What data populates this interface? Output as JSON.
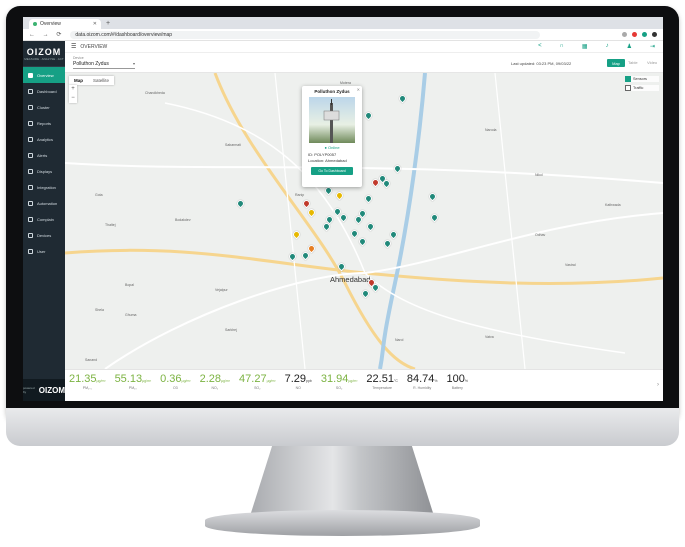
{
  "browser": {
    "tab_title": "Overview",
    "url": "data.oizom.com/#/dashboard/overview/map"
  },
  "sidebar": {
    "brand": "OIZOM",
    "brand_tagline": "MEASURE · ANALYSE · ACT",
    "items": [
      {
        "label": "Overview"
      },
      {
        "label": "Dashboard"
      },
      {
        "label": "Cluster"
      },
      {
        "label": "Reports"
      },
      {
        "label": "Analytics"
      },
      {
        "label": "Alerts"
      },
      {
        "label": "Displays"
      },
      {
        "label": "Integration"
      },
      {
        "label": "Automation"
      },
      {
        "label": "Complain"
      },
      {
        "label": "Devices"
      },
      {
        "label": "User"
      }
    ],
    "footer_prefix": "powered by",
    "footer_brand": "OIZOM"
  },
  "topbar": {
    "menu_icon": "menu-icon",
    "title": "OVERVIEW"
  },
  "subbar": {
    "device_label": "Device",
    "device_value": "Polluthon Zydus",
    "last_updated": "Last updated: 03:23 PM, 09/03/22",
    "map_btn": "Map",
    "table_btn": "Table",
    "video_btn": "Video"
  },
  "map": {
    "type_map": "Map",
    "type_satellite": "Satellite",
    "zoom_in": "+",
    "zoom_out": "−",
    "layer_sensors": "Sensors",
    "layer_traffic": "Traffic",
    "city_label": "Ahmedabad",
    "place_labels": [
      "Chandkheda",
      "Motera",
      "Sabarmati",
      "Gota",
      "Bodakdev",
      "Thaltej",
      "Naroda",
      "Nikol",
      "Vastral",
      "Narol",
      "Vatva",
      "Sarkhej",
      "Bopal",
      "Ghuma",
      "Shela",
      "Sanand",
      "Kathwada",
      "Odhav",
      "Ranip",
      "Vejalpur"
    ]
  },
  "popup": {
    "title": "Polluthon Zydus",
    "status": "Online",
    "id_line": "ID: POLYP0057",
    "location_line": "Location: Ahmedabad",
    "button": "Go To Dashboard"
  },
  "parameters": [
    {
      "value": "21.35",
      "unit": "µg/m³",
      "label": "PM₂.₅",
      "style": "green"
    },
    {
      "value": "55.13",
      "unit": "µg/m³",
      "label": "PM₁₀",
      "style": "green"
    },
    {
      "value": "0.36",
      "unit": "µg/m³",
      "label": "O3",
      "style": "green"
    },
    {
      "value": "2.28",
      "unit": "µg/m³",
      "label": "NO₂",
      "style": "green"
    },
    {
      "value": "47.27",
      "unit": "µg/m³",
      "label": "SO₂",
      "style": "green"
    },
    {
      "value": "7.29",
      "unit": "ppb",
      "label": "NO",
      "style": "dark"
    },
    {
      "value": "31.94",
      "unit": "µg/m³",
      "label": "SO₂",
      "style": "green"
    },
    {
      "value": "22.51",
      "unit": "°C",
      "label": "Temperature",
      "style": "dark"
    },
    {
      "value": "84.74",
      "unit": "%",
      "label": "R. Humidity",
      "style": "dark"
    },
    {
      "value": "100",
      "unit": "%",
      "label": "Battery",
      "style": "dark"
    }
  ],
  "colors": {
    "accent": "#16a085",
    "good": "#7cb342",
    "sidebar": "#1f2a33"
  }
}
